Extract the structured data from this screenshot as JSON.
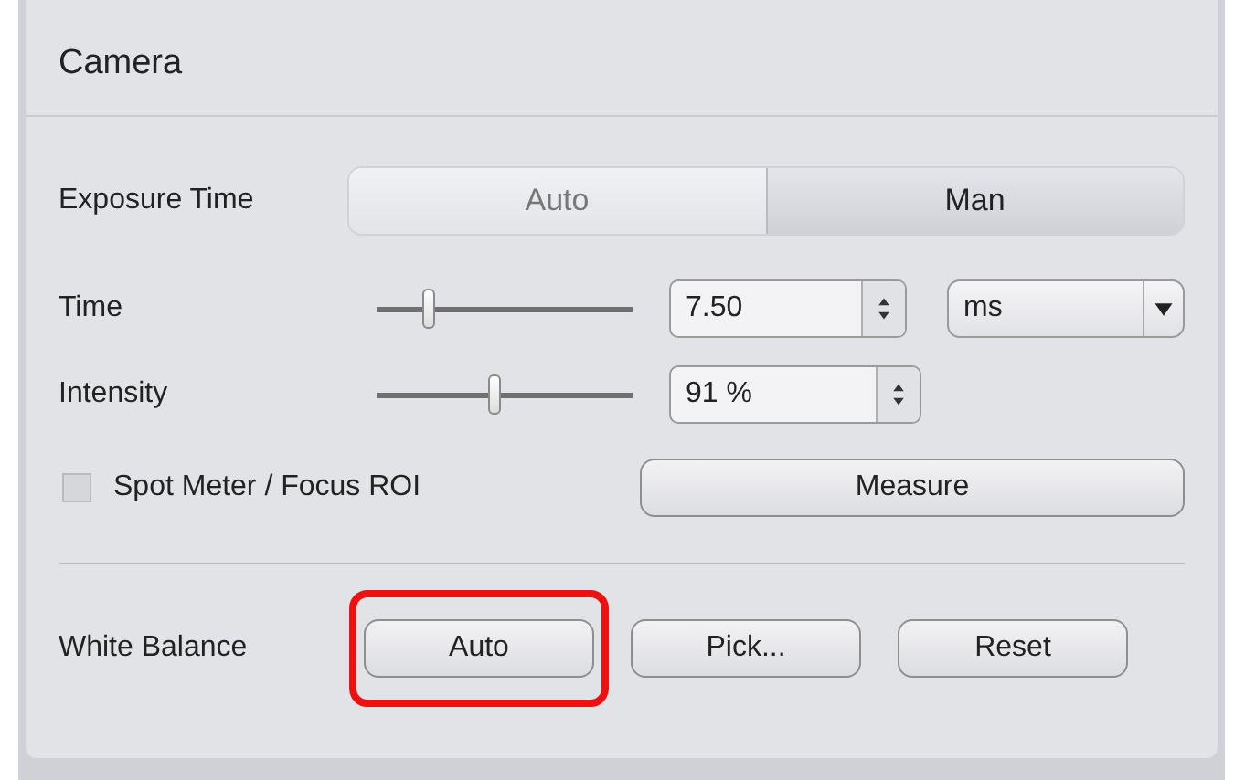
{
  "panel": {
    "title": "Camera"
  },
  "exposure": {
    "label": "Exposure Time",
    "options": [
      {
        "label": "Auto",
        "selected": false
      },
      {
        "label": "Man",
        "selected": true
      }
    ]
  },
  "sliders": [
    {
      "label": "Time",
      "level": 0.2,
      "value": "7.50",
      "unit": "ms"
    },
    {
      "label": "Intensity",
      "level": 0.46,
      "value": "91 %"
    }
  ],
  "spot_meter": {
    "label": "Spot Meter / Focus ROI",
    "checked": false,
    "button": "Measure"
  },
  "white_balance": {
    "label": "White Balance",
    "buttons": [
      {
        "label": "Auto",
        "highlighted": true
      },
      {
        "label": "Pick...",
        "highlighted": false
      },
      {
        "label": "Reset",
        "highlighted": false
      }
    ]
  }
}
